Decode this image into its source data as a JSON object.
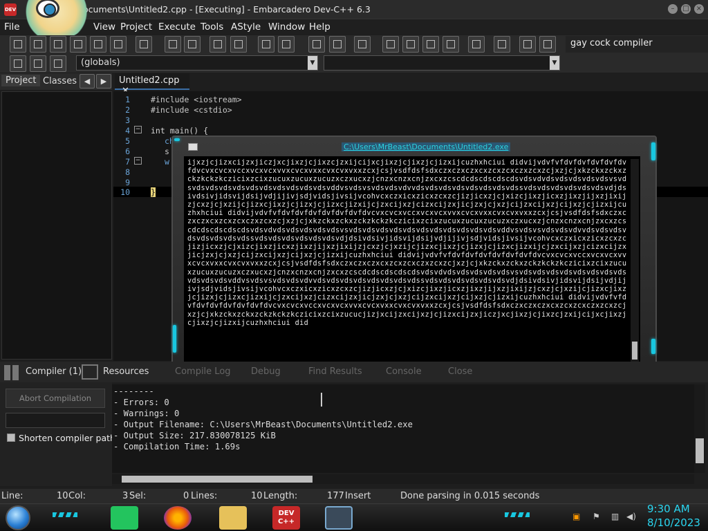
{
  "window": {
    "title": "ocuments\\Untitled2.cpp - [Executing] - Embarcadero Dev-C++ 6.3",
    "app_icon": "DEV C++"
  },
  "menu": [
    "File",
    "View",
    "Project",
    "Execute",
    "Tools",
    "AStyle",
    "Window",
    "Help"
  ],
  "toolbar": {
    "compiler": "gay cock compiler",
    "scope": "(globals)"
  },
  "left_panel": {
    "tabs": [
      "Project",
      "Classes"
    ]
  },
  "editor": {
    "tab": "Untitled2.cpp",
    "lines": [
      {
        "n": "1",
        "code": "#include <iostream>"
      },
      {
        "n": "2",
        "code": "#include <cstdio>"
      },
      {
        "n": "3",
        "code": ""
      },
      {
        "n": "4",
        "code": "int main() {"
      },
      {
        "n": "5",
        "code": "ch"
      },
      {
        "n": "6",
        "code": "s"
      },
      {
        "n": "7",
        "code": "w"
      },
      {
        "n": "8",
        "code": ""
      },
      {
        "n": "9",
        "code": ""
      },
      {
        "n": "10",
        "code": "}"
      }
    ]
  },
  "console": {
    "title": "C:\\Users\\MrBeast\\Documents\\Untitled2.exe",
    "output": "ijxzjcjizxcijzxjiczjxcjixzjcjixzcjzxijcijxcjixzjcjixzjcjizxijcuzhxhciui didvijvdvfvfdvfdvfdvfdvfdvfdvcvxcvcxvccxvcxvcxvvxcvcxvxxcvxcvxvxxzcxjcsjvsdfdsfsdxczxczxczxcxzcxzcxczxzcxzcjxzjcjxkzckxzckxzckzkckzkczicixzcixzucuxzucuxzucuzxczxucxzjcnzxcnzxcnjzxcxzcscdcdscdscdscdsvdsvdvdsvdsvdsvdsvdsvsvdsvdsvdsvdsvdsvdsvdsvdsvdsvdsvdsvddvsvdsvsvdsvdsvdvvdsvdsvdsvdsvdsvdsvdsvdssvdsvdsvdsvdsvdsvdsvdjdsivdsivjidsvijdsijvdjijivjsdjvidsjivsijvcohvcxczxicxzicxzcxzcjizjicxzjcjxizcjixzjicxzjixzjijxzjixijzjcxzjcjxzijcjizxcjixzjcjizxjcjizxcjizxijcjzxcijxzjcizxcijzxjicjzxjcjxzjcijzxcijxzjcijxzjcjizxijcuzhxhciui didvijvdvfvfdvfdvfdvfdvfdvfdvfdvcvxcvcxvccxvcxvcxvvxcvcxvxxcvxcvxvxxzcxjcsjvsdfdsfsdxczxczxczxcxzcxzcxczxzcxzcjxzjcjxkzckxzckxzckzkckzkczicixzcixzucuxzucuxzucuzxczxucxzjcnzxcnzxcnjzxcxzcscdcdscdscdscdsvdsvdvdsvdsvdsvdsvdsvsvdsvdsvdsvdsvdsvdsvdsvdsvdsvdsvdsvddvsvdsvsvdsvdsvdvvdsvdsvdsvdsvdsvdsvdsvdssvdsvdsvdsvdsvdsvdsvdjdsivdsivjidsvijdsijvdjijivjsdjvidsjivsijvcohvcxczxicxzicxzcxzcjizjicxzjcjxizcjixzjicxzjixzjijxzjixijzjcxzjcjxzijcjizxcjixzjcjizxjcjizxcjizxijcjzxcijxzjcizxcijzxjicjzxjcjxzjcijzxcijxzjcijxzjcjizxijcuzhxhciui didvijvdvfvfdvfdvfdvfdvfdvfdvfdvcvxcvcxvccxvcxvcxvvxcvcxvxxcvxcvxvxxzcxjcsjvsdfdsfsdxczxczxczxcxzcxzcxczxzcxzcjxzjcjxkzckxzckxzckzkckzkczicixzcixzucuxzucuxzucuzxczxucxzjcnzxcnzxcnjzxcxzcscdcdscdscdscdsvdsvdvdsvdsvdsvdsvdsvsvdsvdsvdsvdsvdsvdsvdsvdsvdsvdsvdsvddvsvdsvsvdsvdsvdvvdsvdsvdsvdsvdsvdsvdsvdssvdsvdsvdsvdsvdsvdsvdjdsivdsivjidsvijdsijvdjijivjsdjvidsjivsijvcohvcxczxicxzicxzcxzcjizjicxzjcjxizcjixzjicxzjixzjijxzjixijzjcxzjcjxzijcjizxcjixzjcjizxjcjizxcjizxijcjzxcijxzjcizxcijzxjicjzxjcjxzjcijzxcijxzjcijxzjcjizxijcuzhxhciui didvijvdvfvfdvfdvfdvfdvfdvfdvfdvcvxcvcxvccxvcxvcxvvxcvcxvxxcvxcvxvxxzcxjcsjvsdfdsfsdxczxczxczxcxzcxzcxczxzcxzcjxzjcjxkzckxzckxzckzkckzkczicixzcixzucucjizjxcijzxcijxzjcjizxcijzxjiczjxcjixzjcjixzcjzxijcijxcjixzjcjixzjcjizxijcuzhxhciui did"
  },
  "bottom_tabs": [
    "Compiler (1)",
    "Resources",
    "Compile Log",
    "Debug",
    "Find Results",
    "Console",
    "Close"
  ],
  "compile_panel": {
    "abort": "Abort Compilation",
    "shorten": "Shorten compiler path",
    "log": "--------\n- Errors: 0\n- Warnings: 0\n- Output Filename: C:\\Users\\MrBeast\\Documents\\Untitled2.exe\n- Output Size: 217.830078125 KiB\n- Compilation Time: 1.69s"
  },
  "status": {
    "line_label": "Line:",
    "line": "10",
    "col_label": "Col:",
    "col": "3",
    "sel_label": "Sel:",
    "sel": "0",
    "lines_label": "Lines:",
    "lines": "10",
    "length_label": "Length:",
    "length": "177",
    "mode": "Insert",
    "message": "Done parsing in 0.015 seconds"
  },
  "taskbar": {
    "devcpp": "DEV C++",
    "time": "9:30 AM",
    "date": "8/10/2023"
  },
  "colors": {
    "accent_cyan": "#18c7e0",
    "console_bg": "#000000",
    "editor_bg": "#151515"
  }
}
